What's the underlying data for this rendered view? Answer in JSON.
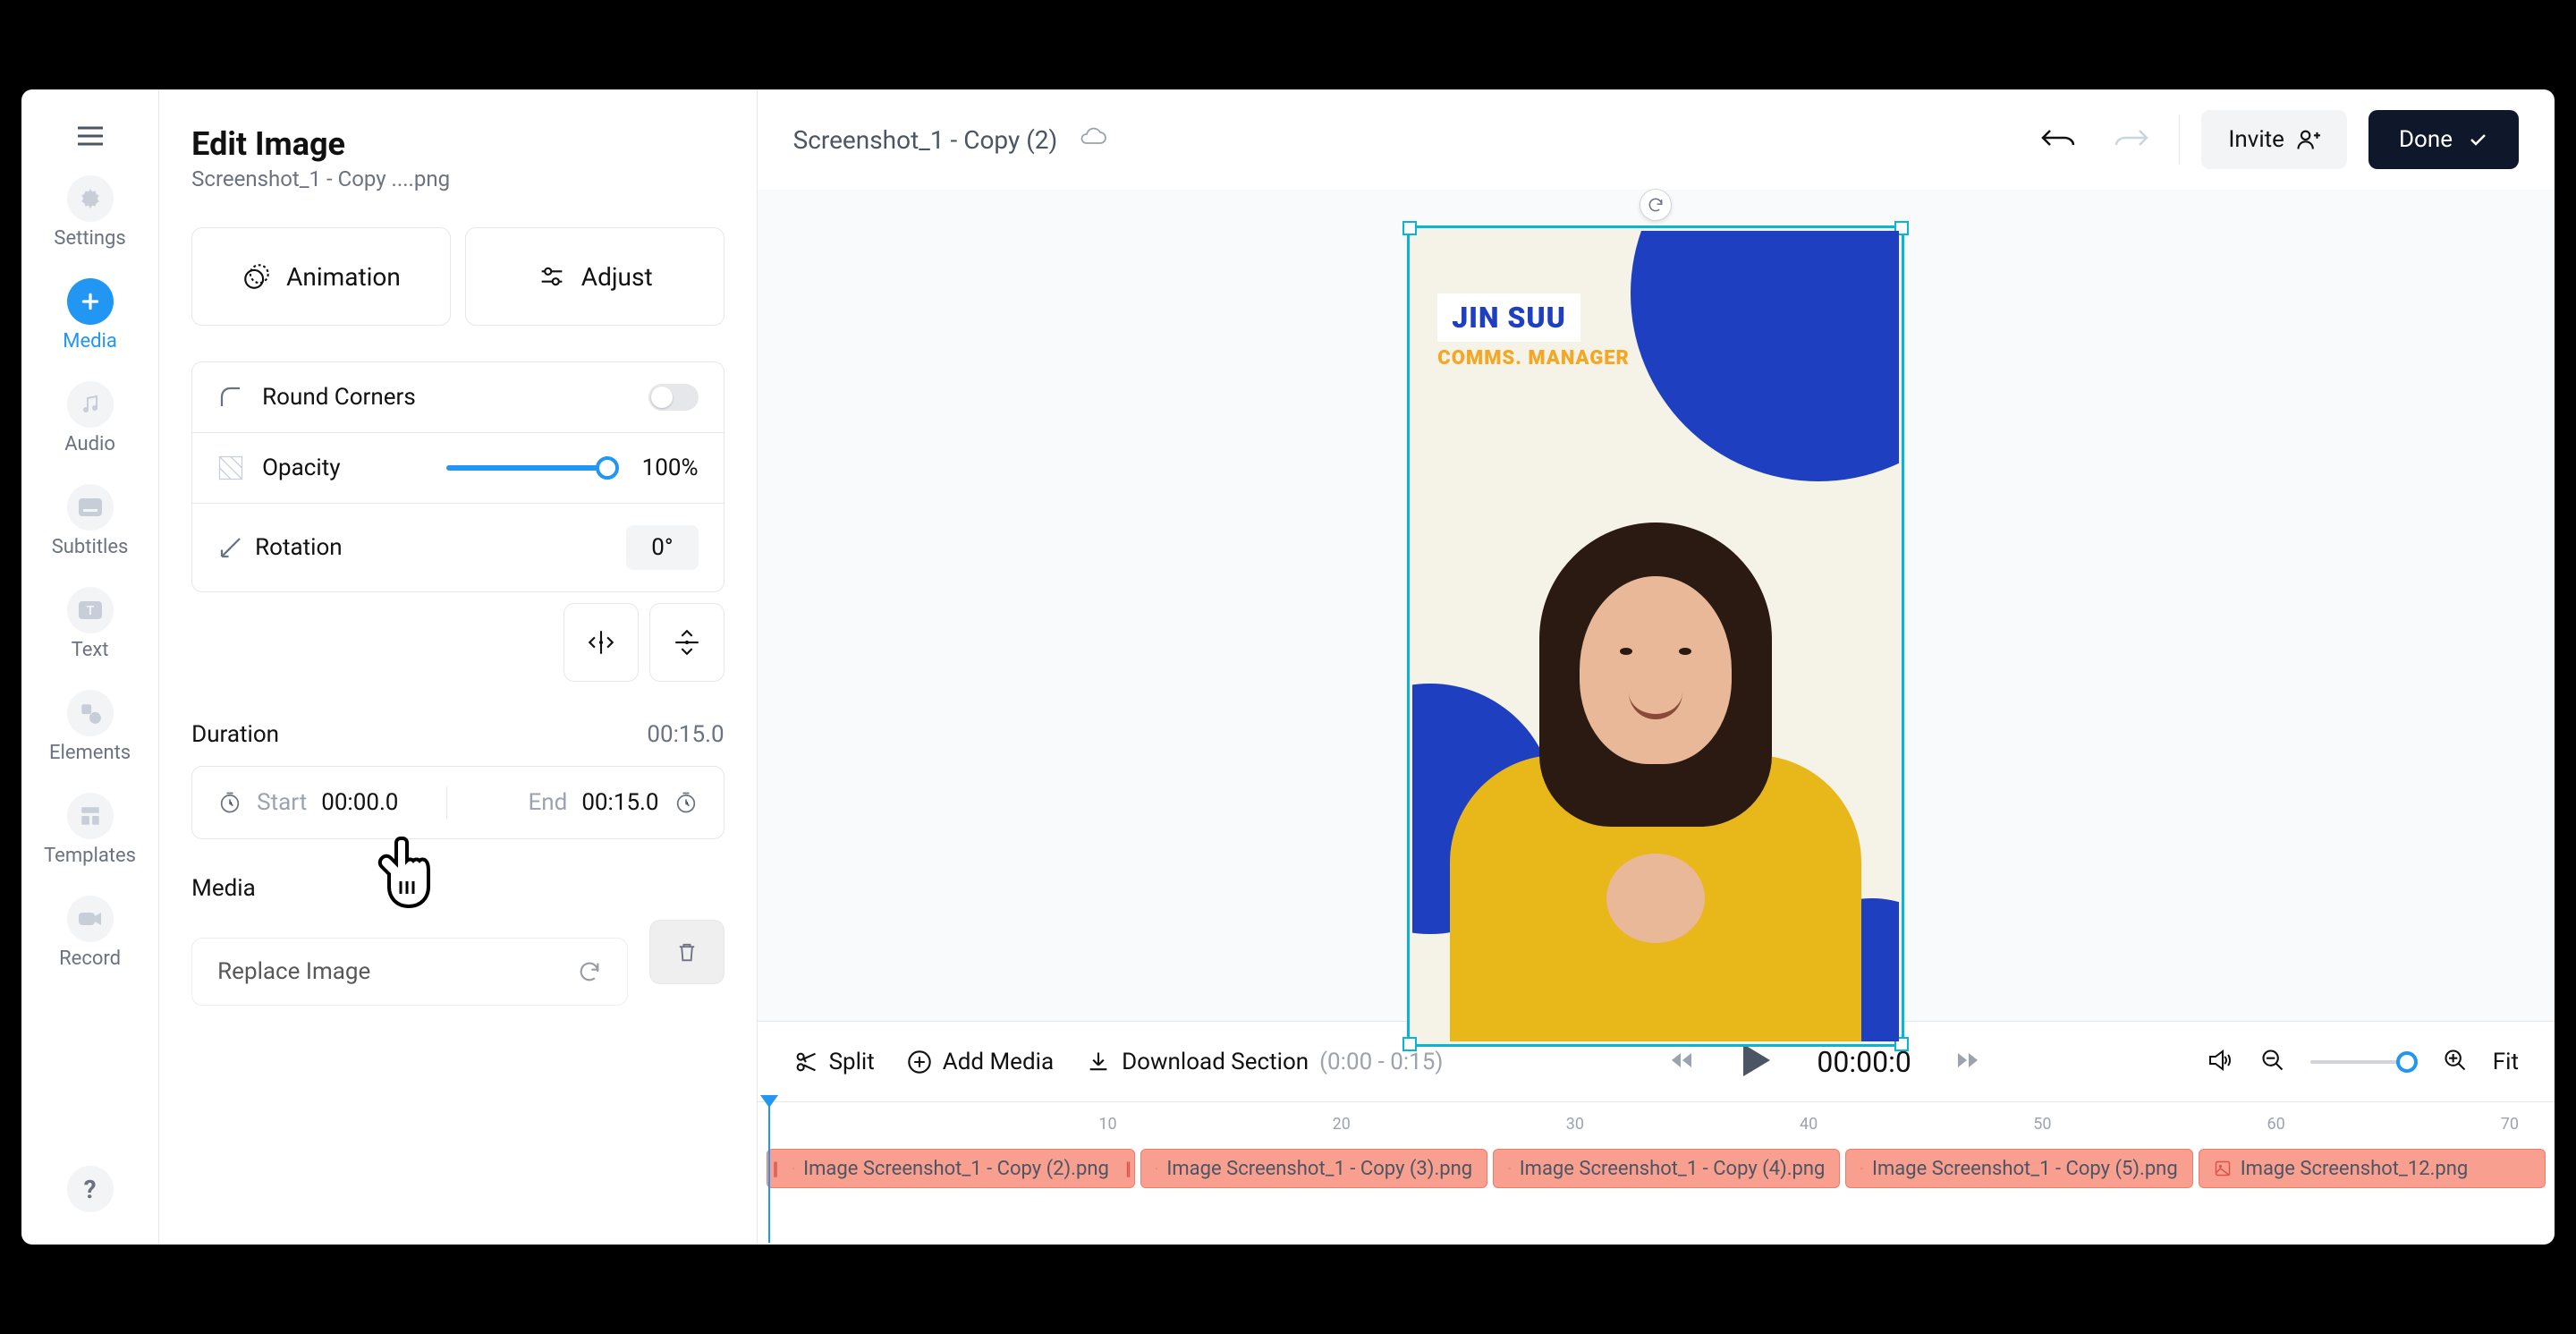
{
  "nav": {
    "items": [
      {
        "label": "Settings"
      },
      {
        "label": "Media"
      },
      {
        "label": "Audio"
      },
      {
        "label": "Subtitles"
      },
      {
        "label": "Text"
      },
      {
        "label": "Elements"
      },
      {
        "label": "Templates"
      },
      {
        "label": "Record"
      }
    ]
  },
  "edit": {
    "title": "Edit Image",
    "subtitle": "Screenshot_1 - Copy ....png",
    "tabs": {
      "animation": "Animation",
      "adjust": "Adjust"
    },
    "round_corners": "Round Corners",
    "opacity_label": "Opacity",
    "opacity_value": "100%",
    "rotation_label": "Rotation",
    "rotation_value": "0°",
    "duration_label": "Duration",
    "duration_value": "00:15.0",
    "start_label": "Start",
    "start_value": "00:00.0",
    "end_label": "End",
    "end_value": "00:15.0",
    "media_label": "Media",
    "replace": "Replace Image"
  },
  "header": {
    "project_name": "Screenshot_1 - Copy (2)",
    "invite": "Invite",
    "done": "Done"
  },
  "canvas": {
    "badge_name": "JIN SUU",
    "badge_role": "COMMS. MANAGER"
  },
  "bottombar": {
    "split": "Split",
    "add_media": "Add Media",
    "download": "Download Section",
    "download_range": "(0:00 - 0:15)",
    "current_time": "00:00:0",
    "fit": "Fit"
  },
  "ruler": {
    "marks": [
      "10",
      "20",
      "30",
      "40",
      "50",
      "60",
      "70"
    ]
  },
  "clips": [
    {
      "label": "Image Screenshot_1 - Copy (2).png",
      "flex": 1,
      "selected": true
    },
    {
      "label": "Image Screenshot_1 - Copy (3).png",
      "flex": 1,
      "selected": false
    },
    {
      "label": "Image Screenshot_1 - Copy (4).png",
      "flex": 1,
      "selected": false
    },
    {
      "label": "Image Screenshot_1 - Copy (5).png",
      "flex": 1,
      "selected": false
    },
    {
      "label": "Image Screenshot_12.png",
      "flex": 1,
      "selected": false
    }
  ]
}
